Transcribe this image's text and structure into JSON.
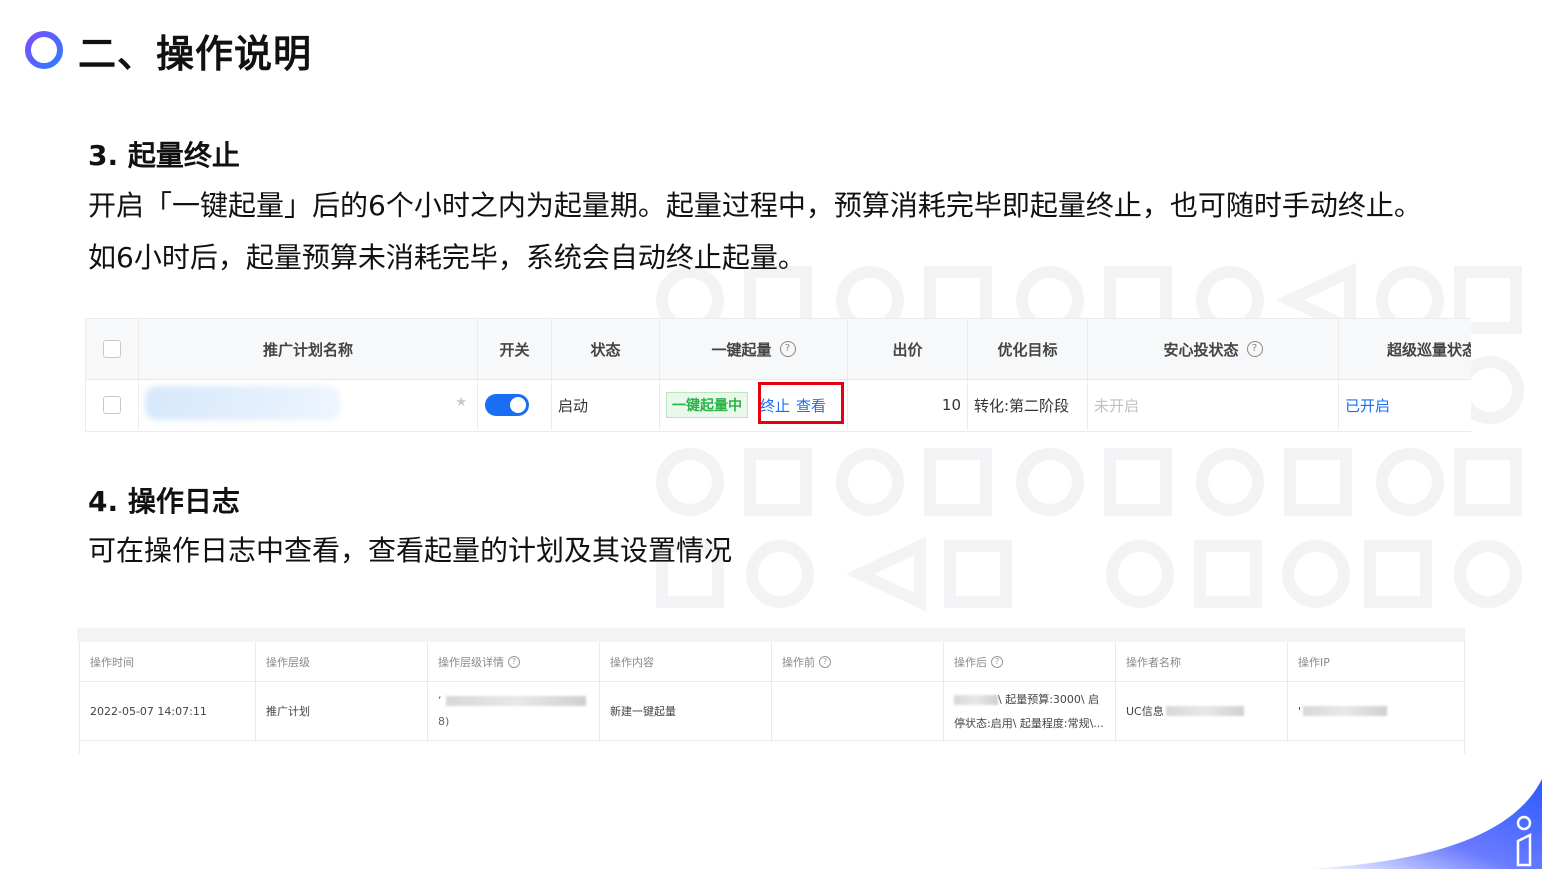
{
  "page": {
    "title": "二、操作说明",
    "section3": {
      "heading": "3. 起量终止",
      "para_line1": "开启「一键起量」后的6个小时之内为起量期。起量过程中，预算消耗完毕即起量终止，也可随时手动终止。",
      "para_line2": "如6小时后，起量预算未消耗完毕，系统会自动终止起量。"
    },
    "section4": {
      "heading": "4. 操作日志",
      "para": "可在操作日志中查看，查看起量的计划及其设置情况"
    }
  },
  "table1": {
    "headers": {
      "name": "推广计划名称",
      "switch": "开关",
      "status": "状态",
      "boost": "一键起量",
      "bid": "出价",
      "target": "优化目标",
      "safe": "安心投状态",
      "super": "超级巡量状态"
    },
    "row": {
      "status": "启动",
      "boost_tag": "一键起量中",
      "stop_link": "终止",
      "view_link": "查看",
      "bid": "10",
      "target": "转化:第二阶段",
      "safe": "未开启",
      "super": "已开启",
      "switch_on": true
    }
  },
  "table2": {
    "headers": [
      "操作时间",
      "操作层级",
      "操作层级详情",
      "操作内容",
      "操作前",
      "操作后",
      "操作者名称",
      "操作IP"
    ],
    "row": {
      "time": "2022-05-07 14:07:11",
      "level": "推广计划",
      "detail_line1": "‘",
      "detail_line2": "8)",
      "content": "新建一键起量",
      "before": "",
      "after_line1_tail": "\\ 起量预算:3000\\ 启",
      "after_line2": "停状态:启用\\ 起量程度:常规\\...",
      "operator": "UC信息",
      "ip": "'"
    }
  },
  "colors": {
    "accent_blue": "#1a6ef5",
    "highlight_red": "#e60012",
    "tag_green": "#2bb34a",
    "ring_gradient": [
      "#7b4dff",
      "#2f7bff"
    ]
  },
  "icons": [
    "ring-logo-icon",
    "help-circle-icon",
    "star-icon",
    "toggle-switch",
    "checkbox",
    "corner-brand-icon"
  ]
}
